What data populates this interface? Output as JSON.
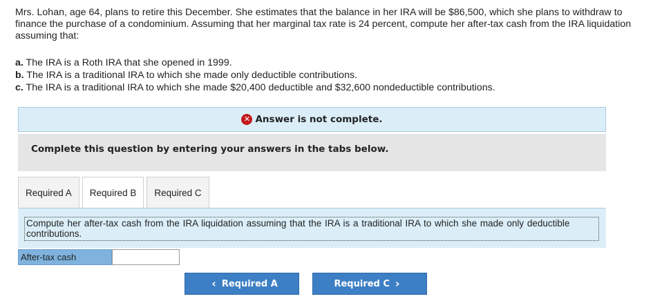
{
  "question": {
    "text": "Mrs. Lohan, age 64, plans to retire this December. She estimates that the balance in her IRA will be $86,500, which she plans to withdraw to finance the purchase of a condominium. Assuming that her marginal tax rate is 24 percent, compute her after-tax cash from the IRA liquidation assuming that:"
  },
  "parts": [
    {
      "letter": "a.",
      "text": " The IRA is a Roth IRA that she opened in 1999."
    },
    {
      "letter": "b.",
      "text": " The IRA is a traditional IRA to which she made only deductible contributions."
    },
    {
      "letter": "c.",
      "text": " The IRA is a traditional IRA to which she made $20,400 deductible and $32,600 nondeductible contributions."
    }
  ],
  "banner": {
    "icon": "error-x-icon",
    "text": "Answer is not complete.",
    "color": "#c41a1a"
  },
  "instruction": "Complete this question by entering your answers in the tabs below.",
  "tabs": [
    {
      "label": "Required A",
      "active": false
    },
    {
      "label": "Required B",
      "active": true
    },
    {
      "label": "Required C",
      "active": false
    }
  ],
  "panel_text": "Compute her after-tax cash from the IRA liquidation assuming that the IRA is a traditional IRA to which she made only deductible contributions.",
  "field": {
    "label": "After-tax cash",
    "value": ""
  },
  "nav": {
    "prev_label": "Required A",
    "next_label": "Required C",
    "prev_icon": "chevron-left-icon",
    "next_icon": "chevron-right-icon",
    "accent": "#3d7fc4"
  }
}
